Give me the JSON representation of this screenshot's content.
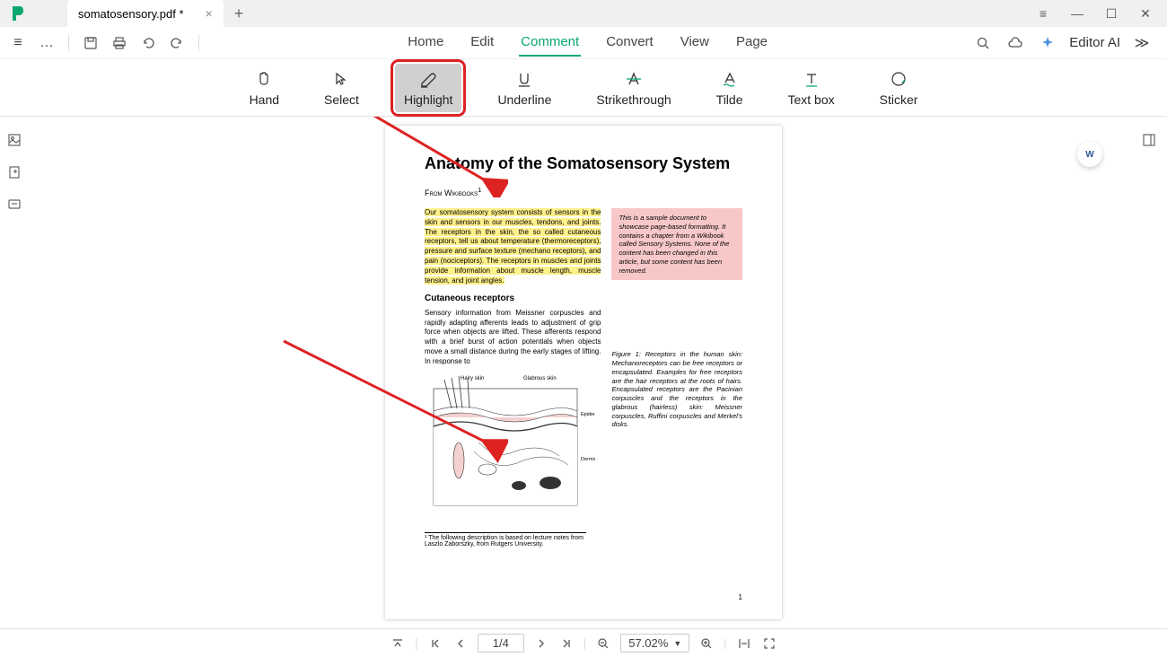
{
  "titlebar": {
    "tab_name": "somatosensory.pdf *"
  },
  "quickbar": {
    "editor_ai": "Editor AI"
  },
  "menu": {
    "items": [
      "Home",
      "Edit",
      "Comment",
      "Convert",
      "View",
      "Page"
    ],
    "active_index": 2
  },
  "ribbon": {
    "tools": [
      {
        "label": "Hand",
        "name": "hand-tool"
      },
      {
        "label": "Select",
        "name": "select-tool"
      },
      {
        "label": "Highlight",
        "name": "highlight-tool"
      },
      {
        "label": "Underline",
        "name": "underline-tool"
      },
      {
        "label": "Strikethrough",
        "name": "strikethrough-tool"
      },
      {
        "label": "Tilde",
        "name": "tilde-tool"
      },
      {
        "label": "Text box",
        "name": "textbox-tool"
      },
      {
        "label": "Sticker",
        "name": "sticker-tool"
      }
    ],
    "highlighted_index": 2
  },
  "document": {
    "title": "Anatomy of the Somatosensory System",
    "from": "From Wikibooks",
    "para1_hl": "Our somatosensory system consists of sensors in the skin and sensors in our muscles, tendons, and joints. The receptors in the skin, the so called cutaneous receptors, tell us about temperature (thermoreceptors), pressure and surface texture (mechano receptors), and pain (nociceptors). The receptors in muscles and joints provide information about muscle length, muscle tension, and joint angles.",
    "note": "This is a sample document to showcase page-based formatting. It contains a chapter from a Wikibook called Sensory Systems. None of the content has been changed in this article, but some content has been removed.",
    "subhead": "Cutaneous receptors",
    "para2": "Sensory information from Meissner corpuscles and rapidly adapting afferents leads to adjustment of grip force when objects are lifted. These afferents respond with a brief burst of action potentials when objects move a small distance during the early stages of lifting. In response to",
    "fig_caption": "Figure 1: Receptors in the human skin: Mechanoreceptors can be free receptors or encapsulated. Examples for free receptors are the hair receptors at the roots of hairs. Encapsulated receptors are the Pacinian corpuscles and the receptors in the glabrous (hairless) skin: Meissner corpuscles, Ruffini corpuscles and Merkel's disks.",
    "footnote": "¹ The following description is based on lecture notes from Laszlo Zaborszky, from Rutgers University.",
    "page_num": "1",
    "fig_labels": {
      "hairy": "Hairy skin",
      "glabrous": "Glabrous skin",
      "epidermis": "Epidermis",
      "dermis": "Dermis"
    }
  },
  "statusbar": {
    "page": "1/4",
    "zoom": "57.02%"
  }
}
